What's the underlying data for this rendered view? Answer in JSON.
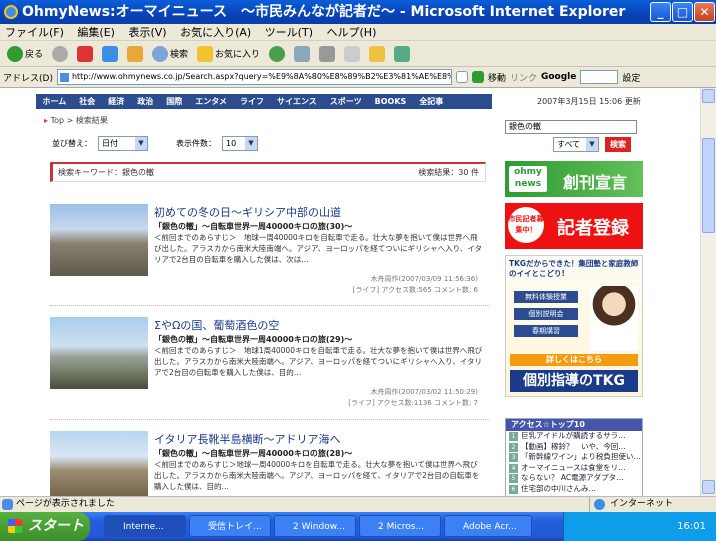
{
  "window": {
    "title": "OhmyNews:オーマイニュース　～市民みんなが記者だ～ - Microsoft Internet Explorer"
  },
  "menu": [
    "ファイル(F)",
    "編集(E)",
    "表示(V)",
    "お気に入り(A)",
    "ツール(T)",
    "ヘルプ(H)"
  ],
  "toolbar": {
    "back": "戻る",
    "search": "検索",
    "favorites": "お気に入り"
  },
  "address": {
    "label": "アドレス(D)",
    "url": "http://www.ohmynews.co.jp/Search.aspx?query=%E9%8A%80%E8%89%B2%E3%81%AE%E8%BD%8D&c",
    "go": "移動",
    "links": "リンク",
    "google": "Google",
    "settings": "設定"
  },
  "site": {
    "nav": [
      "ホーム",
      "社会",
      "経済",
      "政治",
      "国際",
      "エンタメ",
      "ライフ",
      "サイエンス",
      "スポーツ",
      "BOOKS",
      "全記事"
    ],
    "date": "2007年3月15日 15:06 更新",
    "crumb_top": "Top",
    "crumb_current": "検索結果",
    "sort_label": "並び替え：",
    "sort_value": "日付",
    "count_label": "表示件数：",
    "count_value": "10",
    "keyword_label": "検索キーワード：",
    "keyword": "銀色の轍",
    "result_label": "検索結果：30 件"
  },
  "articles": [
    {
      "title": "初めての冬の日～ギリシア中部の山道",
      "subtitle": "「銀色の轍」～自転車世界一周40000キロの旅(30)～",
      "body": "＜前回までのあらすじ＞　地球一周40000キロを自転車で走る。壮大な夢を抱いて僕は世界へ飛び出した。アラスカから南米大陸南端へ。アジア、ヨーロッパを経てついにギリシャへ入り、イタリアで2台目の自転車を購入した僕は、次は…",
      "author": "木舟周作(2007/03/09 11:56:36)",
      "meta": "[ライフ] アクセス数:565 コメント数: 6"
    },
    {
      "title": "ΣやΩの国、葡萄酒色の空",
      "subtitle": "「銀色の轍」～自転車世界一周40000キロの旅(29)～",
      "body": "＜前回までのあらすじ＞　地球1周40000キロを自転車で走る。壮大な夢を抱いて僕は世界へ飛び出した。アラスカから南米大陸南端へ。アジア、ヨーロッパを経てついにギリシャへ入り、イタリアで2台目の自転車を購入した僕は、目的…",
      "author": "木舟周作(2007/03/02 11:50:29)",
      "meta": "[ライフ] アクセス数:1136 コメント数: 7"
    },
    {
      "title": "イタリア長靴半島横断～アドリア海へ",
      "subtitle": "「銀色の轍」～自転車世界一周40000キロの旅(28)～",
      "body": "＜前回までのあらすじ＞地球一周40000キロを自転車で走る。壮大な夢を抱いて僕は世界へ飛び出した。アラスカから南米大陸南端へ。アジア、ヨーロッパを経て、イタリアで2台目の自転車を購入した僕は、目的…",
      "author": "",
      "meta": ""
    }
  ],
  "sidebar": {
    "search_value": "銀色の轍",
    "scope": "すべて",
    "search_btn": "検索",
    "banner1_logo": "ohmy news",
    "banner1_text": "創刊宣言",
    "banner2_badge": "市民記者募集中！",
    "banner2_text": "記者登録",
    "banner3_head": "TKGだからできた！集団塾と家庭教師のイイとこどり!",
    "banner3_btns": [
      "無料体験授業",
      "個別説明会",
      "春期講習"
    ],
    "banner3_more": "詳しくはこちら",
    "banner3_foot": "個別指導のTKG",
    "ranking_title": "アクセス☆トップ10",
    "ranking": [
      "巨乳アイドルが購読するサラ…",
      "【動画】稼鈴？　いや、今回…",
      "「新幹線ワイン」より税負担使い…",
      "オーマイニュースは食堂をリ…",
      "ならない？ AC電源アダプタ…",
      "住宅部の中川さんみ…"
    ]
  },
  "status": {
    "text": "ページが表示されました",
    "zone": "インターネット"
  },
  "taskbar": {
    "start": "スタート",
    "tasks": [
      "Interne...",
      "受信トレイ...",
      "2 Window...",
      "2 Micros...",
      "Adobe Acr..."
    ],
    "clock": "16:01"
  }
}
